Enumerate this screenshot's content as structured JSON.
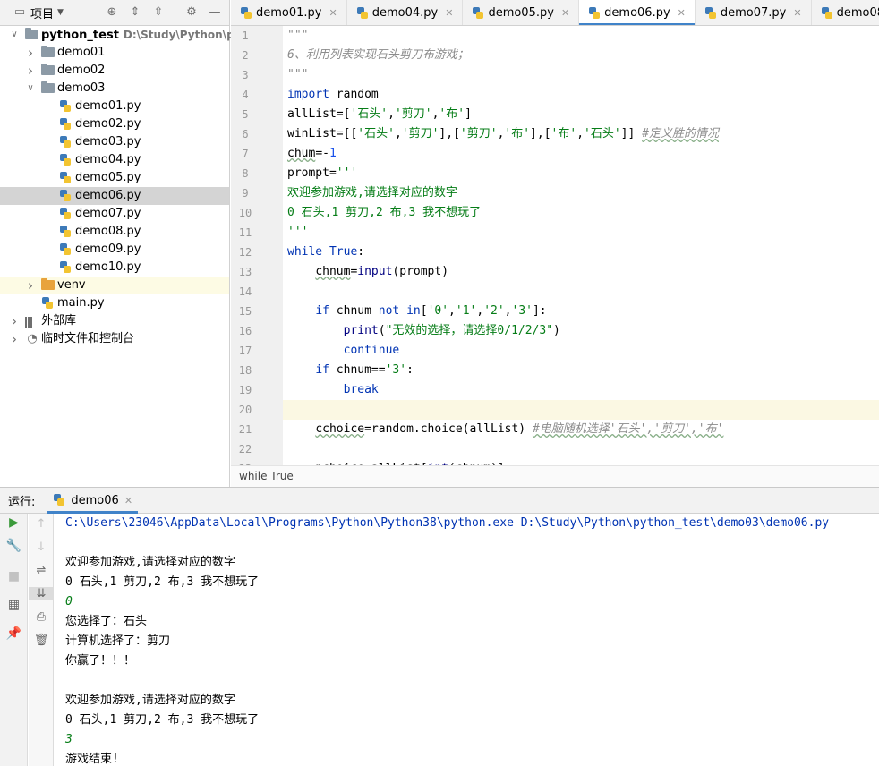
{
  "project_panel": {
    "title": "项目",
    "tree": [
      {
        "label": "python_test",
        "path": "D:\\Study\\Python\\pytho",
        "type": "root-folder",
        "depth": 0,
        "expanded": true
      },
      {
        "label": "demo01",
        "type": "folder",
        "depth": 1,
        "expanded": false
      },
      {
        "label": "demo02",
        "type": "folder",
        "depth": 1,
        "expanded": false
      },
      {
        "label": "demo03",
        "type": "folder",
        "depth": 1,
        "expanded": true
      },
      {
        "label": "demo01.py",
        "type": "py",
        "depth": 2
      },
      {
        "label": "demo02.py",
        "type": "py",
        "depth": 2
      },
      {
        "label": "demo03.py",
        "type": "py",
        "depth": 2
      },
      {
        "label": "demo04.py",
        "type": "py",
        "depth": 2
      },
      {
        "label": "demo05.py",
        "type": "py",
        "depth": 2
      },
      {
        "label": "demo06.py",
        "type": "py",
        "depth": 2,
        "selected": true
      },
      {
        "label": "demo07.py",
        "type": "py",
        "depth": 2
      },
      {
        "label": "demo08.py",
        "type": "py",
        "depth": 2
      },
      {
        "label": "demo09.py",
        "type": "py",
        "depth": 2
      },
      {
        "label": "demo10.py",
        "type": "py",
        "depth": 2
      },
      {
        "label": "venv",
        "type": "venv-folder",
        "depth": 1,
        "expanded": false
      },
      {
        "label": "main.py",
        "type": "py",
        "depth": 1
      },
      {
        "label": "外部库",
        "type": "library",
        "depth": 0,
        "expanded": false
      },
      {
        "label": "临时文件和控制台",
        "type": "scratch",
        "depth": 0,
        "expanded": false
      }
    ]
  },
  "tabs": [
    {
      "label": "demo01.py",
      "active": false
    },
    {
      "label": "demo04.py",
      "active": false
    },
    {
      "label": "demo05.py",
      "active": false
    },
    {
      "label": "demo06.py",
      "active": true
    },
    {
      "label": "demo07.py",
      "active": false
    },
    {
      "label": "demo08.py",
      "active": false
    },
    {
      "label": "d",
      "active": false
    }
  ],
  "editor": {
    "current_line": 20,
    "lines": [
      {
        "n": "1",
        "html": "<span class=\"cmt\">\"\"\"</span>"
      },
      {
        "n": "2",
        "html": "<span class=\"cmt\">6、利用列表实现石头剪刀布游戏；</span>"
      },
      {
        "n": "3",
        "html": "<span class=\"cmt\">\"\"\"</span>"
      },
      {
        "n": "4",
        "html": "<span class=\"kw\">import</span> random"
      },
      {
        "n": "5",
        "html": "allList=[<span class=\"str\">'石头'</span>,<span class=\"str\">'剪刀'</span>,<span class=\"str\">'布'</span>]"
      },
      {
        "n": "6",
        "html": "winList=[[<span class=\"str\">'石头'</span>,<span class=\"str\">'剪刀'</span>],[<span class=\"str\">'剪刀'</span>,<span class=\"str\">'布'</span>],[<span class=\"str\">'布'</span>,<span class=\"str\">'石头'</span>]] <span class=\"sc squig\">#定义胜的情况</span>"
      },
      {
        "n": "7",
        "html": "<span class=\"squig\">chum</span>=-<span class=\"num\">1</span>"
      },
      {
        "n": "8",
        "html": "prompt=<span class=\"str\">'''</span>"
      },
      {
        "n": "9",
        "html": "<span class=\"str\">欢迎参加游戏,请选择对应的数字</span>"
      },
      {
        "n": "10",
        "html": "<span class=\"str\">0 石头,1 剪刀,2 布,3 我不想玩了</span>"
      },
      {
        "n": "11",
        "html": "<span class=\"str\">'''</span>"
      },
      {
        "n": "12",
        "html": "<span class=\"kw\">while</span> <span class=\"kw\">True</span>:"
      },
      {
        "n": "13",
        "html": "    <span class=\"squig\">chnum</span>=<span class=\"builtin\">input</span>(prompt)"
      },
      {
        "n": "14",
        "html": ""
      },
      {
        "n": "15",
        "html": "    <span class=\"kw\">if</span> chnum <span class=\"kw\">not in</span>[<span class=\"str\">'0'</span>,<span class=\"str\">'1'</span>,<span class=\"str\">'2'</span>,<span class=\"str\">'3'</span>]:"
      },
      {
        "n": "16",
        "html": "        <span class=\"builtin\">print</span>(<span class=\"str\">\"无效的选择，请选择0/1/2/3\"</span>)"
      },
      {
        "n": "17",
        "html": "        <span class=\"kw\">continue</span>"
      },
      {
        "n": "18",
        "html": "    <span class=\"kw\">if</span> chnum==<span class=\"str\">'3'</span>:"
      },
      {
        "n": "19",
        "html": "        <span class=\"kw\">break</span>"
      },
      {
        "n": "20",
        "html": ""
      },
      {
        "n": "21",
        "html": "    <span class=\"squig\">cchoice</span>=random.choice(allList) <span class=\"sc squig\">#电脑随机选择'石头','剪刀','布'</span>"
      },
      {
        "n": "22",
        "html": ""
      },
      {
        "n": "23",
        "html": "    <span class=\"squig\">pchoice</span>=allList[<span class=\"builtin\">int</span>(chnum)]"
      }
    ]
  },
  "breadcrumb": "while True",
  "run": {
    "label": "运行:",
    "tab_label": "demo06",
    "console": [
      {
        "text": "C:\\Users\\23046\\AppData\\Local\\Programs\\Python\\Python38\\python.exe D:\\Study\\Python\\python_test\\demo03\\demo06.py",
        "kind": "cmd"
      },
      {
        "text": "",
        "kind": "out"
      },
      {
        "text": "欢迎参加游戏,请选择对应的数字",
        "kind": "out"
      },
      {
        "text": "0 石头,1 剪刀,2 布,3 我不想玩了",
        "kind": "out"
      },
      {
        "text": "0",
        "kind": "input"
      },
      {
        "text": "您选择了：石头",
        "kind": "out"
      },
      {
        "text": "计算机选择了：剪刀",
        "kind": "out"
      },
      {
        "text": "你赢了！！！",
        "kind": "out"
      },
      {
        "text": "",
        "kind": "out"
      },
      {
        "text": "欢迎参加游戏,请选择对应的数字",
        "kind": "out"
      },
      {
        "text": "0 石头,1 剪刀,2 布,3 我不想玩了",
        "kind": "out"
      },
      {
        "text": "3",
        "kind": "input"
      },
      {
        "text": "游戏结束!",
        "kind": "out"
      }
    ]
  },
  "colors": {
    "accent": "#4083c9",
    "keyword": "#0033b3",
    "string": "#067d17",
    "number": "#1750eb",
    "comment": "#8c8c8c",
    "selection": "#d4d4d4",
    "current_line": "#fbf8e3"
  },
  "icons": {
    "panel": "project-panel-icon",
    "locate": "crosshair-icon",
    "expand": "expand-all-icon",
    "collapse": "collapse-all-icon",
    "settings": "gear-icon",
    "hide": "minimize-icon"
  }
}
